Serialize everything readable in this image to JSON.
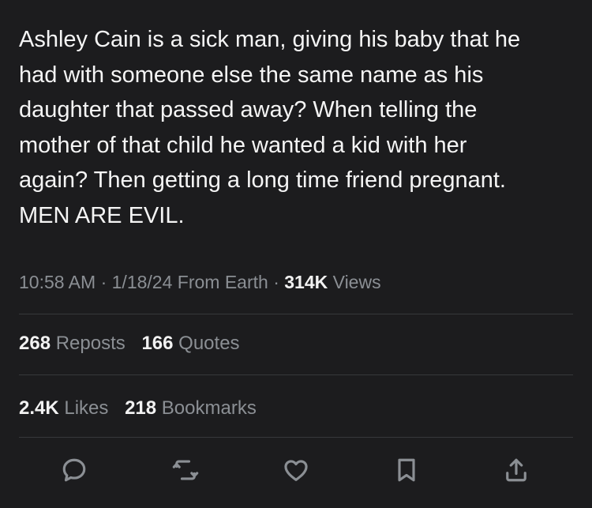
{
  "post": {
    "text_lines": [
      "Ashley Cain is a sick man, giving his baby that he",
      "had with someone else the same name as his",
      "daughter that passed away? When telling the",
      "mother of that child he wanted a kid with her",
      "again? Then getting a long time friend pregnant.",
      "MEN ARE EVIL."
    ]
  },
  "meta": {
    "time": "10:58 AM",
    "sep1": "·",
    "date": "1/18/24",
    "source": "From Earth",
    "sep2": "·",
    "views_count": "314K",
    "views_label": "Views"
  },
  "stats_row1": [
    {
      "count": "268",
      "label": "Reposts"
    },
    {
      "count": "166",
      "label": "Quotes"
    }
  ],
  "stats_row2": [
    {
      "count": "2.4K",
      "label": "Likes"
    },
    {
      "count": "218",
      "label": "Bookmarks"
    }
  ],
  "actions": [
    {
      "icon": "reply-icon"
    },
    {
      "icon": "repost-icon"
    },
    {
      "icon": "heart-icon"
    },
    {
      "icon": "bookmark-icon"
    },
    {
      "icon": "share-icon"
    }
  ],
  "colors": {
    "background": "#1c1c1e",
    "text_primary": "#f5f5f5",
    "text_secondary": "#8b8f94",
    "divider": "#36383b"
  }
}
